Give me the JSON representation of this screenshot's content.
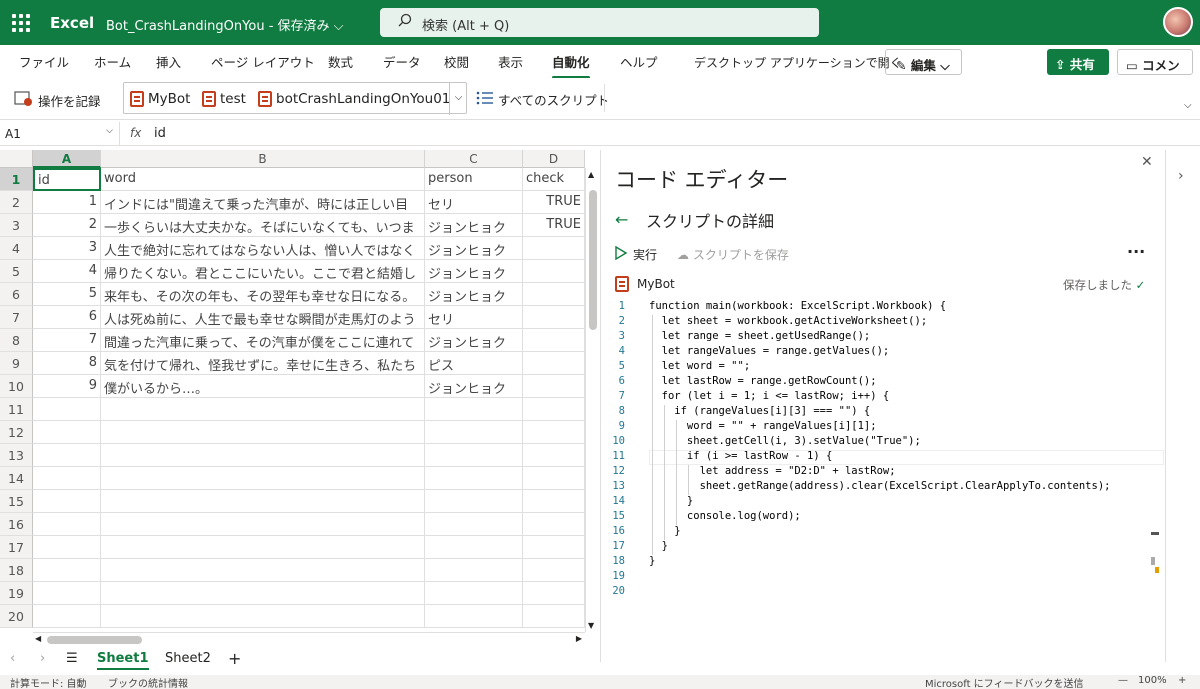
{
  "app": {
    "name": "Excel",
    "doc_title": "Bot_CrashLandingOnYou",
    "save_status": "- 保存済み",
    "search_placeholder": "検索 (Alt + Q)"
  },
  "menu": {
    "tabs": [
      "ファイル",
      "ホーム",
      "挿入",
      "ページ レイアウト",
      "数式",
      "データ",
      "校閲",
      "表示",
      "自動化",
      "ヘルプ"
    ],
    "active_tab": "自動化",
    "open_desktop": "デスクトップ アプリケーションで開く",
    "edit": "編集",
    "share": "共有",
    "comment": "コメント"
  },
  "ribbon": {
    "record": "操作を記録",
    "scripts": [
      "MyBot",
      "test",
      "botCrashLandingOnYou01"
    ],
    "all_scripts": "すべてのスクリプト"
  },
  "formula": {
    "cell_ref": "A1",
    "fx": "fx",
    "value": "id"
  },
  "sheet": {
    "columns": [
      "A",
      "B",
      "C",
      "D"
    ],
    "row_numbers": [
      "1",
      "2",
      "3",
      "4",
      "5",
      "6",
      "7",
      "8",
      "9",
      "10",
      "11",
      "12",
      "13",
      "14",
      "15",
      "16",
      "17",
      "18",
      "19",
      "20"
    ],
    "header": [
      "id",
      "word",
      "person",
      "check"
    ],
    "rows": [
      [
        "1",
        "インドには\"間違えて乗った汽車が、時には正しい目",
        "セリ",
        "TRUE"
      ],
      [
        "2",
        "一歩くらいは大丈夫かな。そばにいなくても、いつま",
        "ジョンヒョク",
        "TRUE"
      ],
      [
        "3",
        "人生で絶対に忘れてはならない人は、憎い人ではなく",
        "ジョンヒョク",
        ""
      ],
      [
        "4",
        "帰りたくない。君とここにいたい。ここで君と結婚し",
        "ジョンヒョク",
        ""
      ],
      [
        "5",
        "来年も、その次の年も、その翌年も幸せな日になる。",
        "ジョンヒョク",
        ""
      ],
      [
        "6",
        "人は死ぬ前に、人生で最も幸せな瞬間が走馬灯のよう",
        "セリ",
        ""
      ],
      [
        "7",
        "間違った汽車に乗って、その汽車が僕をここに連れて",
        "ジョンヒョク",
        ""
      ],
      [
        "8",
        "気を付けて帰れ、怪我せずに。幸せに生きろ、私たち",
        "ピス",
        ""
      ],
      [
        "9",
        "僕がいるから…。",
        "ジョンヒョク",
        ""
      ]
    ],
    "tabs": [
      "Sheet1",
      "Sheet2"
    ],
    "active_tab": "Sheet1",
    "add_sheet": "+"
  },
  "status": {
    "mode": "計算モード: 自動",
    "stats": "ブックの統計情報",
    "feedback": "Microsoft にフィードバックを送信",
    "zoom": "100%"
  },
  "editor": {
    "title": "コード エディター",
    "subtitle": "スクリプトの詳細",
    "run": "実行",
    "save_script": "スクリプトを保存",
    "script_name": "MyBot",
    "saved": "保存しました",
    "line_numbers": [
      "1",
      "2",
      "3",
      "4",
      "5",
      "6",
      "7",
      "8",
      "9",
      "10",
      "11",
      "12",
      "13",
      "14",
      "15",
      "16",
      "17",
      "18",
      "19",
      "20"
    ],
    "lines": [
      "function main(workbook: ExcelScript.Workbook) {",
      "  let sheet = workbook.getActiveWorksheet();",
      "  let range = sheet.getUsedRange();",
      "  let rangeValues = range.getValues();",
      "  let word = \"\";",
      "  let lastRow = range.getRowCount();",
      "  for (let i = 1; i <= lastRow; i++) {",
      "    if (rangeValues[i][3] === \"\") {",
      "      word = \"\" + rangeValues[i][1];",
      "      sheet.getCell(i, 3).setValue(\"True\");",
      "      if (i >= lastRow - 1) {",
      "        let address = \"D2:D\" + lastRow;",
      "        sheet.getRange(address).clear(ExcelScript.ClearApplyTo.contents);",
      "      }",
      "      console.log(word);",
      "    }",
      "  }",
      "}",
      "",
      ""
    ]
  }
}
